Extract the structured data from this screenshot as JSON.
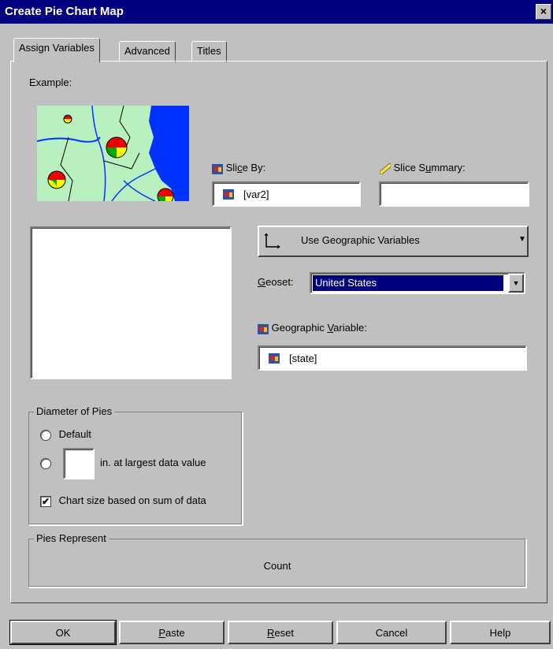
{
  "window": {
    "title": "Create Pie Chart Map",
    "close_glyph": "×"
  },
  "tabs": [
    {
      "label": "Assign Variables"
    },
    {
      "label": "Advanced"
    },
    {
      "label": "Titles"
    }
  ],
  "example": {
    "label": "Example:"
  },
  "slice_by": {
    "label_pre": "Sli",
    "label_u": "c",
    "label_post": "e By:",
    "value": "[var2]"
  },
  "slice_summary": {
    "label_pre": "Slice S",
    "label_u": "u",
    "label_post": "mmary:",
    "value": ""
  },
  "geo_dropdown": {
    "value": "Use Geographic Variables"
  },
  "geoset": {
    "label_u": "G",
    "label_post": "eoset:",
    "value": "United States"
  },
  "geo_variable": {
    "label_pre": "Geographic ",
    "label_u": "V",
    "label_post": "ariable:",
    "value": "[state]"
  },
  "diameter": {
    "title": "Diameter of Pies",
    "default_label": "Default",
    "largest_label": "in. at largest data value",
    "largest_value": "",
    "chart_size_label": "Chart size based on sum of data",
    "chart_size_checked": "✔"
  },
  "pies_represent": {
    "title": "Pies Represent",
    "value": "Count"
  },
  "buttons": {
    "ok": "OK",
    "paste_u": "P",
    "paste_post": "aste",
    "reset_u": "R",
    "reset_post": "eset",
    "cancel": "Cancel",
    "help": "Help"
  },
  "colors": {
    "title_bar": "#000080",
    "selection": "#000080",
    "map_land": "#b8f0c0",
    "map_water": "#0033ff"
  },
  "icons": {
    "variable": "nominal-variable-icon",
    "ruler": "ruler-icon",
    "axes": "axes-icon"
  }
}
